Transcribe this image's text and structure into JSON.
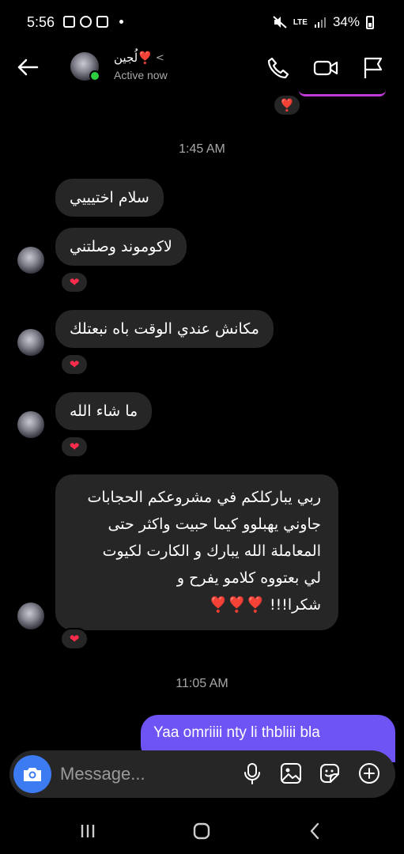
{
  "status_bar": {
    "time": "5:56",
    "network": "LTE",
    "battery": "34%"
  },
  "header": {
    "contact_name": "لُجين❣️",
    "chevron": "<",
    "status": "Active now",
    "icons": [
      "back-arrow-icon",
      "phone-icon",
      "video-camera-icon",
      "flag-icon"
    ]
  },
  "chat": {
    "top_reaction": "❣️",
    "timestamp_1": "1:45 AM",
    "messages": [
      {
        "text": "سلام اختيييي"
      },
      {
        "text": "لاكوموند وصلتني",
        "reaction": "❤"
      },
      {
        "text": "مكانش عندي الوقت باه نبعتلك",
        "reaction": "❤"
      },
      {
        "text": "ما شاء الله",
        "reaction": "❤"
      },
      {
        "lines": [
          "ربي يباركلكم في مشروعكم الحجابات",
          "جاوني يهبلوو كيما حبيت واكثر حتى",
          "المعاملة الله يبارك و الكارت  لكيوت",
          "لي بعتووه كلامو يفرح و",
          "شكرا!!! ❣️❣️❣️"
        ],
        "reaction": "❤"
      }
    ],
    "timestamp_2": "11:05 AM",
    "sent_message": "Yaa omriiii nty li thbliii bla"
  },
  "composer": {
    "placeholder": "Message...",
    "icons": [
      "camera-icon",
      "microphone-icon",
      "gallery-icon",
      "sticker-icon",
      "plus-icon"
    ]
  },
  "colors": {
    "background": "#000000",
    "received_bubble": "#262626",
    "sent_bubble": "#6e53f5",
    "online": "#2ecc40",
    "camera_button": "#3d7bf2",
    "reaction_heart": "#ff2d4b"
  }
}
